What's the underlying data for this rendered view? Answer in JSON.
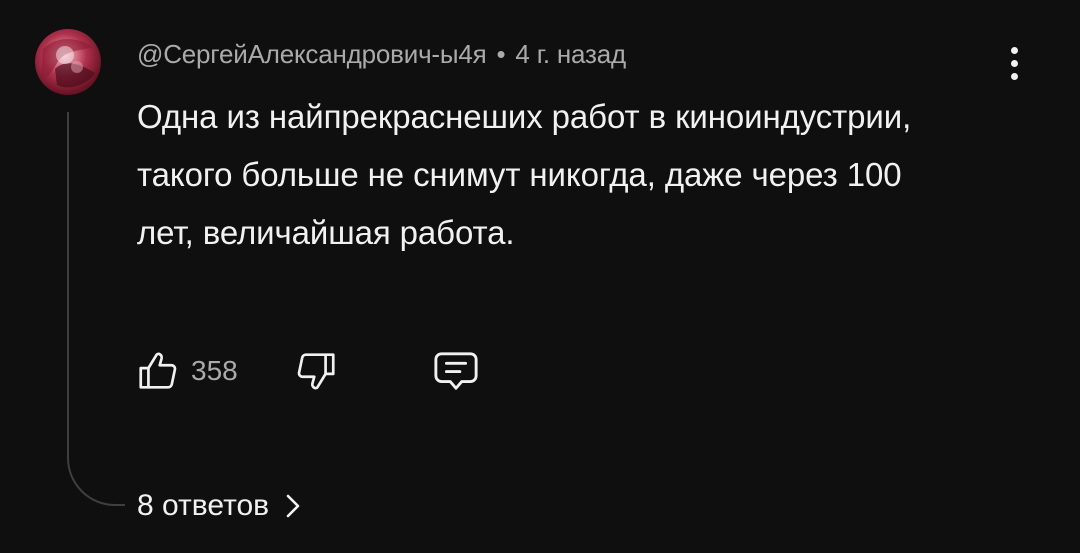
{
  "comment": {
    "author": "@СергейАлександрович-ы4я",
    "separator": "•",
    "time": "4 г. назад",
    "text": "Одна из найпрекраснеших работ в киноиндустрии, такого больше не снимут никогда, даже через 100 лет, величайшая работа.",
    "likes": "358",
    "replies_label": "8 ответов"
  },
  "icons": {
    "more": "more-vert-icon",
    "like": "thumb-up-icon",
    "dislike": "thumb-down-icon",
    "reply": "comment-icon",
    "expand": "chevron-right-icon"
  },
  "colors": {
    "background": "#0f0f0f",
    "text": "#f1f1f1",
    "secondary_text": "#aaaaaa",
    "thread_line": "#3f3f3f"
  }
}
